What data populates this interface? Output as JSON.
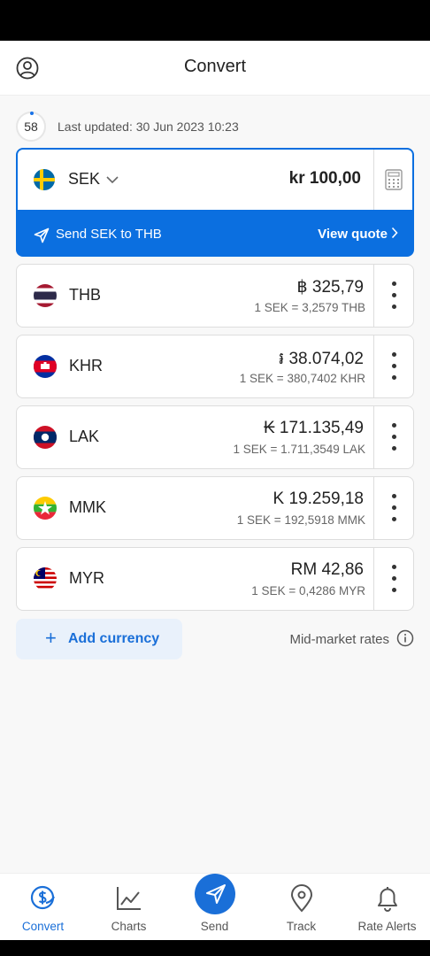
{
  "header": {
    "title": "Convert"
  },
  "status": {
    "timer": "58",
    "last_updated": "Last updated: 30 Jun 2023 10:23"
  },
  "base": {
    "code": "SEK",
    "amount": "kr 100,00",
    "send_label": "Send SEK to THB",
    "quote_label": "View quote"
  },
  "currencies": [
    {
      "code": "THB",
      "value": "฿ 325,79",
      "rate": "1 SEK = 3,2579 THB"
    },
    {
      "code": "KHR",
      "value": "៛ 38.074,02",
      "rate": "1 SEK = 380,7402 KHR"
    },
    {
      "code": "LAK",
      "value": "₭ 171.135,49",
      "rate": "1 SEK = 1.711,3549 LAK"
    },
    {
      "code": "MMK",
      "value": "K 19.259,18",
      "rate": "1 SEK = 192,5918 MMK"
    },
    {
      "code": "MYR",
      "value": "RM 42,86",
      "rate": "1 SEK = 0,4286 MYR"
    }
  ],
  "actions": {
    "add_currency": "Add currency",
    "mid_market": "Mid-market rates"
  },
  "nav": [
    {
      "label": "Convert",
      "icon": "dollar-circle-icon"
    },
    {
      "label": "Charts",
      "icon": "chart-icon"
    },
    {
      "label": "Send",
      "icon": "send-icon"
    },
    {
      "label": "Track",
      "icon": "location-pin-icon"
    },
    {
      "label": "Rate Alerts",
      "icon": "bell-icon"
    }
  ],
  "colors": {
    "accent": "#1a6fd8",
    "base_bar": "#0b6fe0"
  }
}
